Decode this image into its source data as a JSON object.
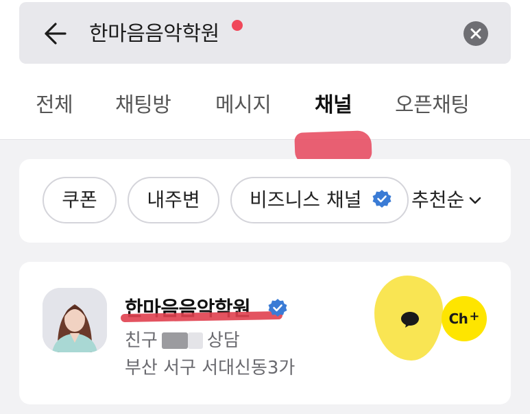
{
  "search": {
    "query": "한마음음악학원",
    "back_icon": "arrow-left-icon",
    "clear_icon": "close-circle-icon"
  },
  "tabs": [
    {
      "label": "전체",
      "active": false
    },
    {
      "label": "채팅방",
      "active": false
    },
    {
      "label": "메시지",
      "active": false
    },
    {
      "label": "채널",
      "active": true
    },
    {
      "label": "오픈채팅",
      "active": false
    }
  ],
  "filters": {
    "chips": [
      "쿠폰",
      "내주변",
      "비즈니스 채널"
    ],
    "sort_label": "추천순"
  },
  "result": {
    "name": "한마음음악학원",
    "meta_prefix": "친구",
    "meta_suffix": "상담",
    "address": "부산 서구 서대신동3가",
    "ch_plus_label": "Ch",
    "ch_plus_sign": "+"
  },
  "colors": {
    "accent_yellow": "#fee500",
    "verified_blue": "#3a7bd5",
    "notification_red": "#f0485a"
  }
}
